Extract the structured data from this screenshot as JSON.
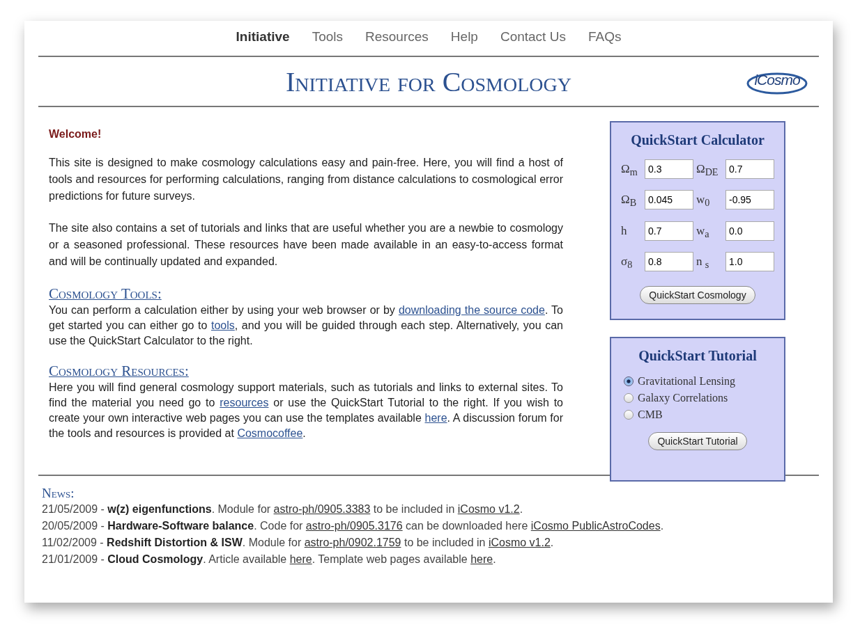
{
  "nav": [
    {
      "label": "Initiative",
      "selected": true
    },
    {
      "label": "Tools",
      "selected": false
    },
    {
      "label": "Resources",
      "selected": false
    },
    {
      "label": "Help",
      "selected": false
    },
    {
      "label": "Contact Us",
      "selected": false
    },
    {
      "label": "FAQs",
      "selected": false
    }
  ],
  "header": {
    "title": "Initiative for Cosmology",
    "logo": "iCosmo"
  },
  "welcome": "Welcome!",
  "intro": [
    "This site is designed to make cosmology calculations easy and pain-free. Here, you will find a host of tools and resources for performing calculations, ranging from distance calculations to cosmological error predictions for future surveys.",
    "The site also contains a set of tutorials and links that are useful whether you are a newbie to cosmology or a seasoned professional. These resources have been made available in an easy-to-access format and will be continually updated and expanded."
  ],
  "sections": [
    {
      "heading": "Cosmology Tools:",
      "segments": [
        {
          "kind": "text",
          "text": "You can perform a calculation either by using your web browser or by "
        },
        {
          "kind": "link",
          "text": "downloading the source code"
        },
        {
          "kind": "text",
          "text": ". To get started you can either go to "
        },
        {
          "kind": "link",
          "text": "tools"
        },
        {
          "kind": "text",
          "text": ", and you will be guided through each step. Alternatively, you can use the QuickStart Calculator to the right."
        }
      ]
    },
    {
      "heading": "Cosmology Resources:",
      "segments": [
        {
          "kind": "text",
          "text": "Here you will find general cosmology support materials, such as tutorials and links to external sites. To find the material you need go to "
        },
        {
          "kind": "link",
          "text": "resources"
        },
        {
          "kind": "text",
          "text": " or use the QuickStart Tutorial to the right. If you wish to create your own interactive web pages you can use the templates available "
        },
        {
          "kind": "link",
          "text": "here"
        },
        {
          "kind": "text",
          "text": ". A discussion forum for the tools and resources is provided at "
        },
        {
          "kind": "link",
          "text": "Cosmocoffee"
        },
        {
          "kind": "text",
          "text": "."
        }
      ]
    }
  ],
  "calculator": {
    "title": "QuickStart Calculator",
    "params": [
      {
        "label": "Ω$_{m}$",
        "value": "0.3"
      },
      {
        "label": "Ω$_{DE}$",
        "value": "0.7"
      },
      {
        "label": "Ω$_{B}$",
        "value": "0.045"
      },
      {
        "label": "w$_{0}$",
        "value": "-0.95"
      },
      {
        "label": "h",
        "value": "0.7"
      },
      {
        "label": "w$_{a}$",
        "value": "0.0"
      },
      {
        "label": "σ$_{8}$",
        "value": "0.8"
      },
      {
        "label": "n $_{s}$",
        "value": "1.0"
      }
    ],
    "button": "QuickStart Cosmology"
  },
  "tutorial": {
    "title": "QuickStart Tutorial",
    "options": [
      {
        "label": "Gravitational Lensing",
        "selected": true
      },
      {
        "label": "Galaxy Correlations",
        "selected": false
      },
      {
        "label": "CMB",
        "selected": false
      }
    ],
    "button": "QuickStart Tutorial"
  },
  "news": {
    "heading": "News:",
    "items": [
      {
        "segments": [
          {
            "kind": "text",
            "text": "21/05/2009 - "
          },
          {
            "kind": "bold",
            "text": "w(z) eigenfunctions"
          },
          {
            "kind": "text",
            "text": ". Module for "
          },
          {
            "kind": "link",
            "text": "astro-ph/0905.3383"
          },
          {
            "kind": "text",
            "text": " to be included in "
          },
          {
            "kind": "link",
            "text": "iCosmo v1.2"
          },
          {
            "kind": "text",
            "text": "."
          }
        ]
      },
      {
        "segments": [
          {
            "kind": "text",
            "text": "20/05/2009 - "
          },
          {
            "kind": "bold",
            "text": "Hardware-Software balance"
          },
          {
            "kind": "text",
            "text": ". Code for "
          },
          {
            "kind": "link",
            "text": "astro-ph/0905.3176"
          },
          {
            "kind": "text",
            "text": " can be downloaded here "
          },
          {
            "kind": "link",
            "text": "iCosmo PublicAstroCodes"
          },
          {
            "kind": "text",
            "text": "."
          }
        ]
      },
      {
        "segments": [
          {
            "kind": "text",
            "text": "11/02/2009 - "
          },
          {
            "kind": "bold",
            "text": "Redshift Distortion & ISW"
          },
          {
            "kind": "text",
            "text": ". Module for "
          },
          {
            "kind": "link",
            "text": "astro-ph/0902.1759"
          },
          {
            "kind": "text",
            "text": " to be included in "
          },
          {
            "kind": "link",
            "text": "iCosmo v1.2"
          },
          {
            "kind": "text",
            "text": "."
          }
        ]
      },
      {
        "segments": [
          {
            "kind": "text",
            "text": "21/01/2009 - "
          },
          {
            "kind": "bold",
            "text": "Cloud Cosmology"
          },
          {
            "kind": "text",
            "text": ". Article available "
          },
          {
            "kind": "link",
            "text": "here"
          },
          {
            "kind": "text",
            "text": ". Template web pages available "
          },
          {
            "kind": "link",
            "text": "here"
          },
          {
            "kind": "text",
            "text": "."
          }
        ]
      }
    ]
  }
}
